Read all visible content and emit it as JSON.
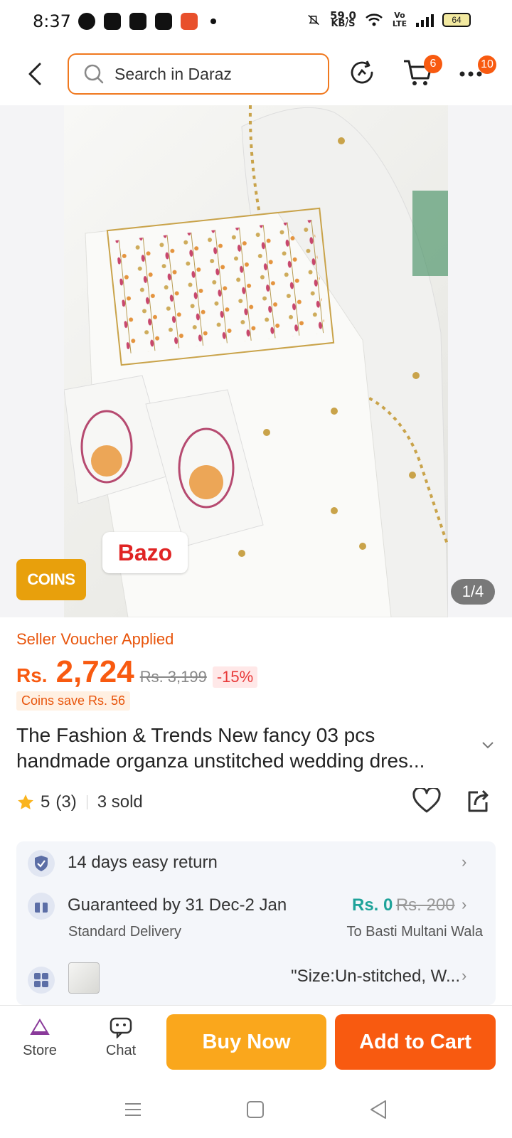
{
  "status_bar": {
    "time": "8:37",
    "net_speed_value": "59.0",
    "net_speed_unit": "KB/S",
    "battery": "64",
    "volte": "Vo LTE"
  },
  "header": {
    "search_placeholder": "Search in Daraz",
    "cart_badge": "6",
    "more_badge": "10"
  },
  "gallery": {
    "coins_tag": "COINS",
    "brand_tag": "Bazo",
    "pager": "1/4"
  },
  "price": {
    "voucher_text": "Seller Voucher Applied",
    "currency": "Rs.",
    "current": "2,724",
    "original": "Rs. 3,199",
    "discount": "-15%",
    "coins_save": "Coins save Rs. 56"
  },
  "product": {
    "title": "The Fashion & Trends New fancy 03 pcs handmade organza unstitched wedding dres...",
    "rating": "5",
    "rating_count": "(3)",
    "sold": "3 sold"
  },
  "services": {
    "return_text": "14 days easy return",
    "delivery_title": "Guaranteed by 31 Dec-2 Jan",
    "delivery_type": "Standard Delivery",
    "delivery_fee": "Rs. 0",
    "delivery_fee_old": "Rs. 200",
    "delivery_to": "To Basti Multani Wala",
    "variant_text": "\"Size:Un-stitched, W..."
  },
  "bottom_bar": {
    "store_label": "Store",
    "chat_label": "Chat",
    "buy_now": "Buy Now",
    "add_to_cart": "Add to Cart"
  },
  "colors": {
    "brand_orange": "#f85a10",
    "buy_now": "#faa71c",
    "coins": "#e8a00c",
    "free_delivery": "#1fa39a"
  }
}
